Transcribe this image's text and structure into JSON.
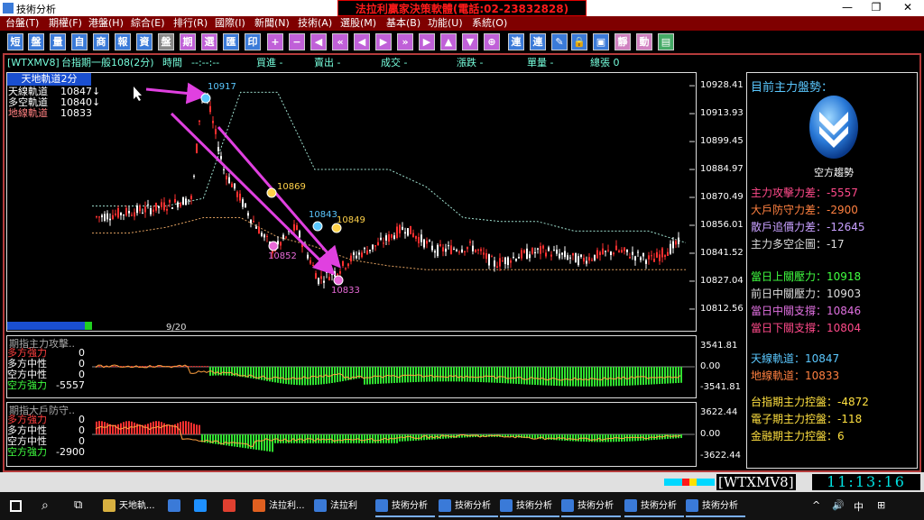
{
  "window": {
    "title": "技術分析",
    "banner": "法拉利贏家決策軟體(電話:02-23832828)",
    "min": "—",
    "restore": "❐",
    "close": "✕"
  },
  "menu": [
    {
      "label": "台盤(T)"
    },
    {
      "label": "期權(F)"
    },
    {
      "label": "港盤(H)"
    },
    {
      "label": "綜合(E)"
    },
    {
      "label": "排行(R)"
    },
    {
      "label": "國際(I)"
    },
    {
      "label": "新聞(N)"
    },
    {
      "label": "技術(A)"
    },
    {
      "label": "選股(M)"
    },
    {
      "label": "基本(B)"
    },
    {
      "label": "功能(U)"
    },
    {
      "label": "系統(O)"
    }
  ],
  "toolbar": {
    "buttons": [
      {
        "label": "短",
        "color": "#3a7ad8"
      },
      {
        "label": "盤",
        "color": "#3a7ad8"
      },
      {
        "label": "量",
        "color": "#3a7ad8"
      },
      {
        "label": "自",
        "color": "#3a7ad8"
      },
      {
        "label": "商",
        "color": "#3a7ad8"
      },
      {
        "label": "報",
        "color": "#3a7ad8"
      },
      {
        "label": "資",
        "color": "#3a7ad8"
      },
      {
        "label": "盤",
        "color": "#888"
      },
      {
        "label": "期",
        "color": "#c060d8"
      },
      {
        "label": "選",
        "color": "#c060d8"
      },
      {
        "label": "匯",
        "color": "#3a7ad8"
      },
      {
        "label": "印",
        "color": "#3a7ad8"
      },
      {
        "label": "+",
        "color": "#c060d8"
      },
      {
        "label": "−",
        "color": "#c060d8"
      },
      {
        "label": "◀",
        "color": "#c060d8"
      },
      {
        "label": "«",
        "color": "#c060d8"
      },
      {
        "label": "◀",
        "color": "#c060d8"
      },
      {
        "label": "▶",
        "color": "#c060d8"
      },
      {
        "label": "»",
        "color": "#c060d8"
      },
      {
        "label": "▶",
        "color": "#c060d8"
      },
      {
        "label": "▲",
        "color": "#c060d8"
      },
      {
        "label": "▼",
        "color": "#c060d8"
      },
      {
        "label": "⊕",
        "color": "#c060d8"
      },
      {
        "label": "連",
        "color": "#3a7ad8"
      },
      {
        "label": "連",
        "color": "#3a7ad8"
      },
      {
        "label": "✎",
        "color": "#3a7ad8"
      },
      {
        "label": "🔒",
        "color": "#3a7ad8"
      },
      {
        "label": "▣",
        "color": "#3a7ad8"
      },
      {
        "label": "靜",
        "color": "#d080c0"
      },
      {
        "label": "動",
        "color": "#d080c0"
      },
      {
        "label": "▤",
        "color": "#44aa66"
      }
    ]
  },
  "infobar": {
    "symbol": "[WTXMV8]",
    "name": "台指期一般108(2分)",
    "time_label": "時間",
    "time_value": "--:--:--",
    "buy": "買進 -",
    "sell": "賣出 -",
    "deal": "成交 -",
    "change": "漲跌 -",
    "vol": "單量 -",
    "total": "總張 0"
  },
  "main": {
    "indicator_header": "天地軌道2分",
    "legend": [
      {
        "name": "天線軌道",
        "value": "10847↓",
        "color": "#fff"
      },
      {
        "name": "多空軌道",
        "value": "10840↓",
        "color": "#fff"
      },
      {
        "name": "地線軌道",
        "value": "10833",
        "color": "#ff8080"
      }
    ],
    "date_label": "9/20",
    "annotations": [
      {
        "label": "10917",
        "color": "#5bc8ff"
      },
      {
        "label": "10869",
        "color": "#ffd24a"
      },
      {
        "label": "10843",
        "color": "#5bc8ff"
      },
      {
        "label": "10849",
        "color": "#ffd24a"
      },
      {
        "label": "10852",
        "color": "#e86ad8"
      },
      {
        "label": "10833",
        "color": "#e86ad8"
      }
    ]
  },
  "panel1": {
    "title": "期指主力攻擊..",
    "rows": [
      {
        "name": "多方強力",
        "value": "0",
        "color": "#ff4040"
      },
      {
        "name": "多方中性",
        "value": "0",
        "color": "#fff"
      },
      {
        "name": "空方中性",
        "value": "0",
        "color": "#fff"
      },
      {
        "name": "空方強力",
        "value": "-5557",
        "color": "#40ff40"
      }
    ],
    "ticks": [
      "3541.81",
      "0.00",
      "-3541.81"
    ]
  },
  "panel2": {
    "title": "期指大戶防守..",
    "rows": [
      {
        "name": "多方強力",
        "value": "0",
        "color": "#ff4040"
      },
      {
        "name": "多方中性",
        "value": "0",
        "color": "#fff"
      },
      {
        "name": "空方中性",
        "value": "0",
        "color": "#fff"
      },
      {
        "name": "空方強力",
        "value": "-2900",
        "color": "#40ff40"
      }
    ],
    "ticks": [
      "3622.44",
      "0.00",
      "-3622.44"
    ]
  },
  "right": {
    "title": "目前主力盤勢：",
    "trend": "空方趨勢",
    "g1": [
      {
        "text": "主力攻擊力差：-5557",
        "color": "#ff4a8a"
      },
      {
        "text": "大戶防守力差：-2900",
        "color": "#ff8040"
      },
      {
        "text": "散戶追價力差：-12645",
        "color": "#c8a0ff"
      },
      {
        "text": "主力多空企圖：-17",
        "color": "#ddd"
      }
    ],
    "g2": [
      {
        "text": "當日上關壓力：10918",
        "color": "#40ff40"
      },
      {
        "text": "前日中關壓力：10903",
        "color": "#ddd"
      },
      {
        "text": "當日中關支撐：10846",
        "color": "#e070e0"
      },
      {
        "text": "當日下關支撐：10804",
        "color": "#ff4a8a"
      }
    ],
    "g3": [
      {
        "text": "天線軌道：10847",
        "color": "#5bc8ff"
      },
      {
        "text": "地線軌道：10833",
        "color": "#ff8040"
      }
    ],
    "g4": [
      {
        "text": "台指期主力控盤：-4872",
        "color": "#ffe040"
      },
      {
        "text": "電子期主力控盤：-118",
        "color": "#ffe040"
      },
      {
        "text": "金融期主力控盤：6",
        "color": "#ffe040"
      }
    ]
  },
  "status": {
    "symbol": "[WTXMV8]",
    "clock": "11:13:16"
  },
  "taskbar": {
    "items": [
      {
        "label": "天地軌...",
        "color": "#d8b040"
      },
      {
        "label": "",
        "color": "#3a7ad8"
      },
      {
        "label": "",
        "color": "#1e90ff"
      },
      {
        "label": "",
        "color": "#e04030"
      },
      {
        "label": "法拉利...",
        "color": "#e06020"
      },
      {
        "label": "法拉利",
        "color": "#3a7ad8"
      },
      {
        "label": "技術分析",
        "color": "#3a7ad8"
      },
      {
        "label": "技術分析",
        "color": "#3a7ad8"
      },
      {
        "label": "技術分析",
        "color": "#3a7ad8"
      },
      {
        "label": "技術分析",
        "color": "#3a7ad8"
      },
      {
        "label": "技術分析",
        "color": "#3a7ad8"
      },
      {
        "label": "技術分析",
        "color": "#3a7ad8"
      }
    ],
    "tray": [
      "^",
      "🔊",
      "中",
      "⊞"
    ]
  },
  "chart_data": [
    {
      "type": "line",
      "title": "天地軌道2分",
      "y_ticks": [
        10928.41,
        10913.93,
        10899.45,
        10884.97,
        10870.49,
        10856.01,
        10841.52,
        10827.04,
        10812.56
      ],
      "series": [
        {
          "name": "天線軌道",
          "values": [
            10866,
            10866,
            10866,
            10870,
            10925,
            10925,
            10885,
            10885,
            10885,
            10876,
            10860,
            10858,
            10858,
            10853,
            10853,
            10853,
            10847
          ]
        },
        {
          "name": "地線軌道",
          "values": [
            10852,
            10852,
            10855,
            10860,
            10860,
            10850,
            10845,
            10838,
            10835,
            10833,
            10833,
            10833,
            10833,
            10833,
            10833,
            10833,
            10833
          ]
        }
      ],
      "ylim": [
        10806,
        10935
      ]
    },
    {
      "type": "bar",
      "title": "期指主力攻擊..",
      "ylim": [
        -3541.81,
        3541.81
      ]
    },
    {
      "type": "bar",
      "title": "期指大戶防守..",
      "ylim": [
        -3622.44,
        3622.44
      ]
    }
  ]
}
